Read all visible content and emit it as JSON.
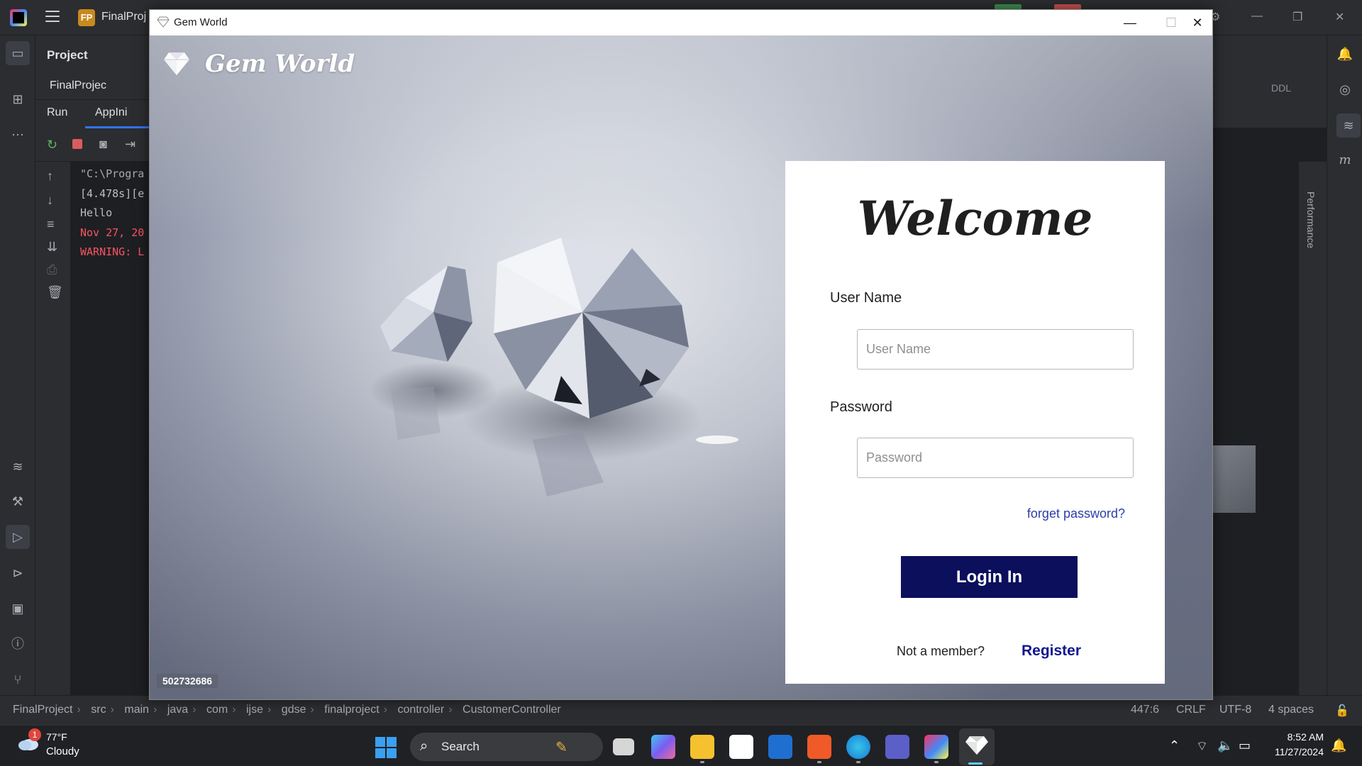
{
  "ide": {
    "project_badge": "FP",
    "project_name": "FinalProj",
    "project_panel_title": "Project",
    "tree_root": "FinalProjec",
    "run_label": "Run",
    "run_tab": "AppIni",
    "ddl_label": "DDL",
    "performance_label": "Performance",
    "console_lines": [
      {
        "text": "\"C:\\Progra",
        "color": "#a8abb2"
      },
      {
        "text": "[4.478s][e",
        "color": "#bcbec4"
      },
      {
        "text": "Hello",
        "color": "#bcbec4"
      },
      {
        "text": "Nov 27, 20",
        "color": "#f75464"
      },
      {
        "text": "WARNING: L",
        "color": "#f75464"
      }
    ],
    "breadcrumbs": [
      "FinalProject",
      "src",
      "main",
      "java",
      "com",
      "ijse",
      "gdse",
      "finalproject",
      "controller",
      "CustomerController"
    ],
    "status": {
      "position": "447:6",
      "line_ending": "CRLF",
      "encoding": "UTF-8",
      "indent": "4 spaces"
    }
  },
  "window": {
    "title": "Gem World",
    "minimize_icon": "minimize-icon",
    "maximize_icon": "maximize-icon",
    "close_icon": "close-icon"
  },
  "app": {
    "brand_name": "Gem World",
    "photo_id": "502732686",
    "login": {
      "heading": "Welcome",
      "username_label": "User Name",
      "username_placeholder": "User Name",
      "username_value": "",
      "password_label": "Password",
      "password_placeholder": "Password",
      "password_value": "",
      "forgot_link": "forget password?",
      "login_button": "Login In",
      "not_member_text": "Not a member?",
      "register_link": "Register"
    },
    "colors": {
      "login_button_bg": "#0b0f5c",
      "register_link": "#12178f",
      "forgot_link": "#2b3ea8"
    }
  },
  "taskbar": {
    "weather_temp": "77°F",
    "weather_desc": "Cloudy",
    "weather_badge": "1",
    "search_label": "Search",
    "time": "8:52 AM",
    "date": "11/27/2024"
  }
}
